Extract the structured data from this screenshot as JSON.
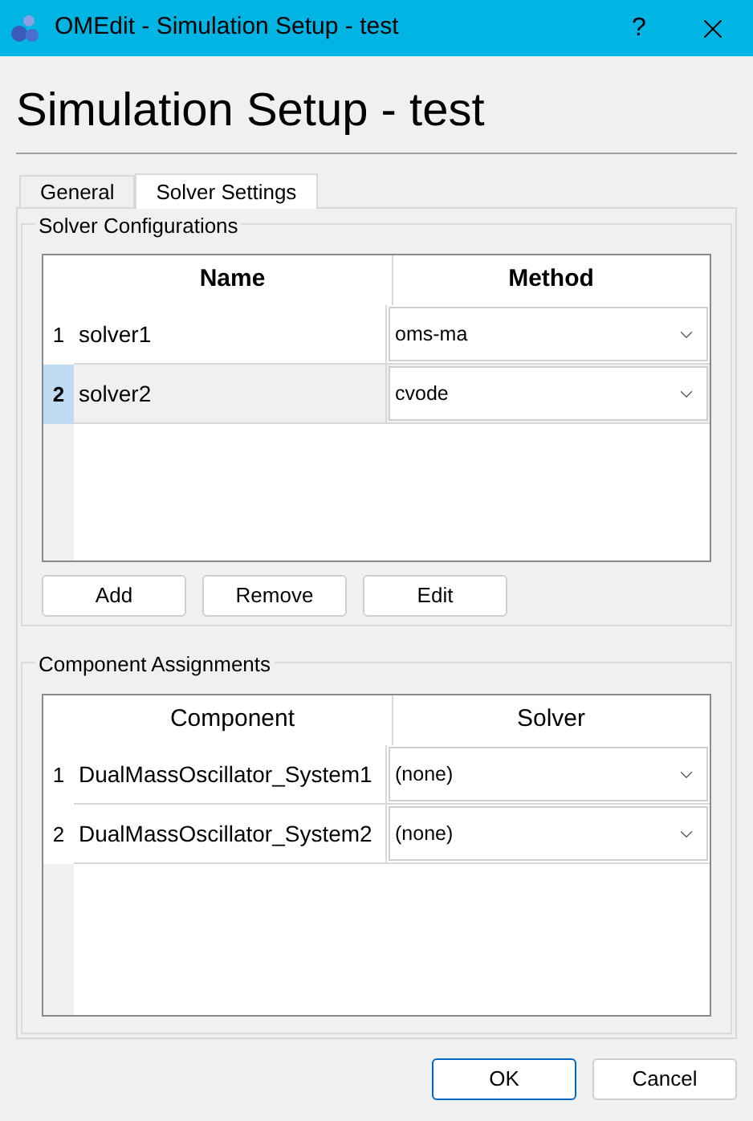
{
  "window": {
    "title": "OMEdit - Simulation Setup - test",
    "help": "?"
  },
  "heading": "Simulation Setup - test",
  "tabs": [
    {
      "label": "General",
      "selected": false
    },
    {
      "label": "Solver Settings",
      "selected": true
    }
  ],
  "solver_configurations": {
    "title": "Solver Configurations",
    "columns": [
      "Name",
      "Method"
    ],
    "rows": [
      {
        "number": "1",
        "name": "solver1",
        "method": "oms-ma",
        "selected": false
      },
      {
        "number": "2",
        "name": "solver2",
        "method": "cvode",
        "selected": true
      }
    ],
    "buttons": [
      "Add",
      "Remove",
      "Edit"
    ]
  },
  "component_assignments": {
    "title": "Component Assignments",
    "columns": [
      "Component",
      "Solver"
    ],
    "rows": [
      {
        "number": "1",
        "name": "DualMassOscillator_System1",
        "method": "(none)",
        "selected": false
      },
      {
        "number": "2",
        "name": "DualMassOscillator_System2",
        "method": "(none)",
        "selected": false
      }
    ]
  },
  "buttons": [
    {
      "label": "OK",
      "default": true
    },
    {
      "label": "Cancel",
      "default": false
    }
  ]
}
